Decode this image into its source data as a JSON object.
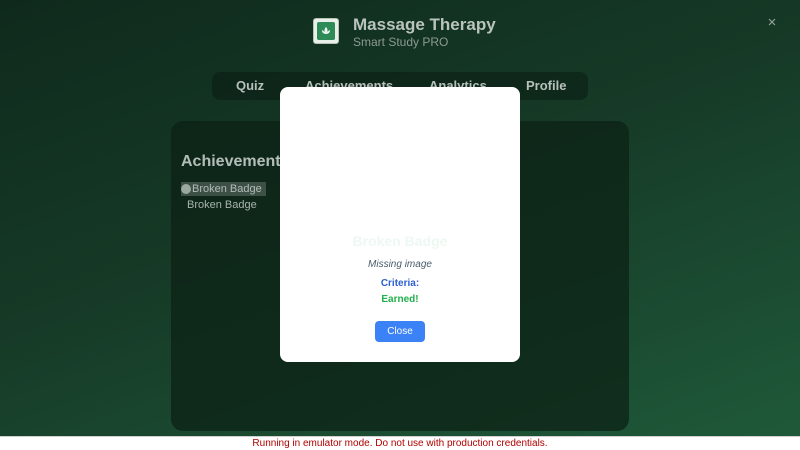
{
  "header": {
    "title": "Massage Therapy",
    "subtitle": "Smart Study PRO",
    "close_glyph": "×",
    "logo_icon": "lotus-icon"
  },
  "nav": {
    "tabs": [
      {
        "label": "Quiz"
      },
      {
        "label": "Achievements"
      },
      {
        "label": "Analytics"
      },
      {
        "label": "Profile"
      }
    ]
  },
  "panel": {
    "title": "Achievements",
    "badges": [
      {
        "image_alt": "Broken Badge",
        "name": "Broken Badge"
      }
    ]
  },
  "modal": {
    "badge_name": "Broken Badge",
    "description": "Missing image",
    "criteria_label": "Criteria:",
    "status": "Earned!",
    "close_label": "Close"
  },
  "footer": {
    "warning": "Running in emulator mode. Do not use with production credentials."
  },
  "colors": {
    "accent": "#3b82f6",
    "earned": "#1fb14a",
    "criteria": "#2b5fd0",
    "warning": "#b00000"
  }
}
